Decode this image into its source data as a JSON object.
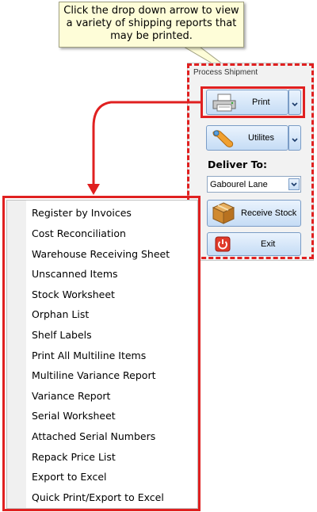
{
  "callout": {
    "lines": [
      "Click the drop down arrow to view",
      "a variety of shipping reports that",
      "may be printed."
    ]
  },
  "panel": {
    "title": "Process Shipment",
    "print_label": "Print",
    "utilities_label": "Utilites",
    "deliver_to_label": "Deliver To:",
    "deliver_to_value": "Gabourel Lane",
    "receive_stock_label": "Receive Stock",
    "exit_label": "Exit"
  },
  "menu": {
    "items": [
      "Register by Invoices",
      "Cost Reconciliation",
      "Warehouse Receiving Sheet",
      "Unscanned Items",
      "Stock Worksheet",
      "Orphan List",
      "Shelf Labels",
      "Print All Multiline Items",
      "Multiline Variance Report",
      "Variance Report",
      "Serial Worksheet",
      "Attached Serial Numbers",
      "Repack Price List",
      "Export to Excel",
      "Quick Print/Export to Excel"
    ]
  },
  "colors": {
    "highlight": "#e02020",
    "callout_bg": "#fefdd8",
    "button_gradient_top": "#eaf3fd",
    "button_gradient_bottom": "#c5dcf5"
  },
  "icons": {
    "print": "printer-icon",
    "utilities": "wrench-icon",
    "receive_stock": "box-icon",
    "exit": "power-icon",
    "dropdown": "chevron-down-icon"
  }
}
